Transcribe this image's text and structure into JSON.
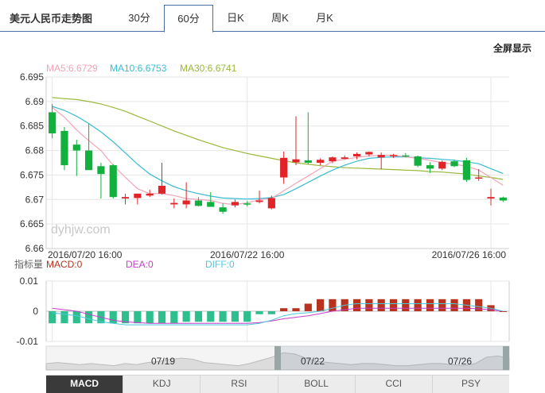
{
  "header": {
    "title": "美元人民币走势图",
    "tabs": [
      {
        "label": "30分",
        "active": false
      },
      {
        "label": "60分",
        "active": true
      },
      {
        "label": "日K",
        "active": false
      },
      {
        "label": "周K",
        "active": false
      },
      {
        "label": "月K",
        "active": false
      }
    ]
  },
  "fullscreen_label": "全屏显示",
  "watermark": "dyhjw.com",
  "colors": {
    "up": "#e2242a",
    "down": "#12b03c",
    "ma5": "#f4a4b6",
    "ma10": "#38bcd4",
    "ma30": "#9ab83c",
    "macd_pos": "#b8321e",
    "macd_neg": "#2fbf8e",
    "dea": "#c83cc8",
    "diff": "#4cc8e0"
  },
  "chart_data": [
    {
      "type": "candlestick",
      "legend": [
        {
          "label": "MA5:6.6729",
          "color": "#f4a4b6"
        },
        {
          "label": "MA10:6.6753",
          "color": "#38bcd4"
        },
        {
          "label": "MA30:6.6741",
          "color": "#9ab83c"
        }
      ],
      "ylim": [
        6.66,
        6.695
      ],
      "yticks": [
        "6.695",
        "6.69",
        "6.685",
        "6.68",
        "6.675",
        "6.67",
        "6.665",
        "6.66"
      ],
      "x_labels": [
        {
          "index": 0,
          "label": "2016/07/20 16:00"
        },
        {
          "index": 16,
          "label": "2016/07/22 16:00"
        },
        {
          "index": 36,
          "label": "2016/07/26 16:00"
        }
      ],
      "candles": [
        {
          "o": 6.6878,
          "h": 6.6895,
          "l": 6.6825,
          "c": 6.6835
        },
        {
          "o": 6.684,
          "h": 6.6848,
          "l": 6.676,
          "c": 6.677
        },
        {
          "o": 6.6812,
          "h": 6.6822,
          "l": 6.6748,
          "c": 6.68
        },
        {
          "o": 6.68,
          "h": 6.6855,
          "l": 6.677,
          "c": 6.676
        },
        {
          "o": 6.6768,
          "h": 6.6775,
          "l": 6.6702,
          "c": 6.6752
        },
        {
          "o": 6.677,
          "h": 6.6772,
          "l": 6.6702,
          "c": 6.6705
        },
        {
          "o": 6.6702,
          "h": 6.6712,
          "l": 6.669,
          "c": 6.6705
        },
        {
          "o": 6.6703,
          "h": 6.6712,
          "l": 6.669,
          "c": 6.6712
        },
        {
          "o": 6.6708,
          "h": 6.672,
          "l": 6.6705,
          "c": 6.6712
        },
        {
          "o": 6.6712,
          "h": 6.6775,
          "l": 6.671,
          "c": 6.6728
        },
        {
          "o": 6.669,
          "h": 6.6702,
          "l": 6.6682,
          "c": 6.6693
        },
        {
          "o": 6.669,
          "h": 6.6735,
          "l": 6.6682,
          "c": 6.6698
        },
        {
          "o": 6.6698,
          "h": 6.6705,
          "l": 6.6686,
          "c": 6.6687
        },
        {
          "o": 6.6695,
          "h": 6.6715,
          "l": 6.6685,
          "c": 6.6685
        },
        {
          "o": 6.6684,
          "h": 6.6692,
          "l": 6.6671,
          "c": 6.6675
        },
        {
          "o": 6.6688,
          "h": 6.67,
          "l": 6.6684,
          "c": 6.6695
        },
        {
          "o": 6.6692,
          "h": 6.6697,
          "l": 6.6686,
          "c": 6.669
        },
        {
          "o": 6.6695,
          "h": 6.6718,
          "l": 6.6692,
          "c": 6.6698
        },
        {
          "o": 6.6682,
          "h": 6.6708,
          "l": 6.668,
          "c": 6.6703
        },
        {
          "o": 6.6745,
          "h": 6.6798,
          "l": 6.6732,
          "c": 6.6785
        },
        {
          "o": 6.6776,
          "h": 6.687,
          "l": 6.677,
          "c": 6.6782
        },
        {
          "o": 6.678,
          "h": 6.6878,
          "l": 6.6772,
          "c": 6.6775
        },
        {
          "o": 6.6775,
          "h": 6.6784,
          "l": 6.677,
          "c": 6.6781
        },
        {
          "o": 6.6778,
          "h": 6.6788,
          "l": 6.6774,
          "c": 6.6786
        },
        {
          "o": 6.6783,
          "h": 6.679,
          "l": 6.6782,
          "c": 6.6786
        },
        {
          "o": 6.6788,
          "h": 6.6796,
          "l": 6.6782,
          "c": 6.6793
        },
        {
          "o": 6.6792,
          "h": 6.6798,
          "l": 6.6788,
          "c": 6.6797
        },
        {
          "o": 6.6786,
          "h": 6.6796,
          "l": 6.6762,
          "c": 6.6791
        },
        {
          "o": 6.6789,
          "h": 6.6793,
          "l": 6.6785,
          "c": 6.6791
        },
        {
          "o": 6.679,
          "h": 6.6795,
          "l": 6.6786,
          "c": 6.6788
        },
        {
          "o": 6.6788,
          "h": 6.679,
          "l": 6.6766,
          "c": 6.6769
        },
        {
          "o": 6.677,
          "h": 6.6776,
          "l": 6.6754,
          "c": 6.6763
        },
        {
          "o": 6.6763,
          "h": 6.678,
          "l": 6.676,
          "c": 6.6777
        },
        {
          "o": 6.6778,
          "h": 6.6781,
          "l": 6.6766,
          "c": 6.6768
        },
        {
          "o": 6.678,
          "h": 6.6785,
          "l": 6.6736,
          "c": 6.674
        },
        {
          "o": 6.6743,
          "h": 6.6762,
          "l": 6.6738,
          "c": 6.6745
        },
        {
          "o": 6.6702,
          "h": 6.6722,
          "l": 6.6688,
          "c": 6.6705
        },
        {
          "o": 6.6704,
          "h": 6.6706,
          "l": 6.6695,
          "c": 6.6698
        }
      ],
      "ma5": [
        6.6888,
        6.6868,
        6.6842,
        6.682,
        6.68,
        6.677,
        6.6745,
        6.6722,
        6.6712,
        6.6712,
        6.6708,
        6.6702,
        6.67,
        6.6698,
        6.6692,
        6.669,
        6.6693,
        6.67,
        6.6702,
        6.6718,
        6.6733,
        6.6748,
        6.6763,
        6.6778,
        6.6782,
        6.6786,
        6.6789,
        6.679,
        6.679,
        6.6787,
        6.6784,
        6.678,
        6.6775,
        6.6772,
        6.6768,
        6.676,
        6.6745,
        6.6729
      ],
      "ma10": [
        6.689,
        6.6882,
        6.687,
        6.6855,
        6.6838,
        6.6818,
        6.6795,
        6.6772,
        6.6752,
        6.6738,
        6.6726,
        6.6718,
        6.6712,
        6.6707,
        6.6703,
        6.6702,
        6.6701,
        6.6702,
        6.6704,
        6.671,
        6.6722,
        6.6735,
        6.6748,
        6.676,
        6.677,
        6.6778,
        6.6784,
        6.6786,
        6.6787,
        6.6787,
        6.6785,
        6.6784,
        6.6782,
        6.678,
        6.6777,
        6.6773,
        6.6763,
        6.6753
      ],
      "ma30": [
        6.6908,
        6.6906,
        6.6904,
        6.69,
        6.6895,
        6.6888,
        6.688,
        6.687,
        6.686,
        6.685,
        6.684,
        6.6831,
        6.6822,
        6.6814,
        6.6806,
        6.68,
        6.6794,
        6.6789,
        6.6784,
        6.6779,
        6.6775,
        6.6772,
        6.6769,
        6.6767,
        6.6765,
        6.6764,
        6.6763,
        6.6762,
        6.6761,
        6.676,
        6.6759,
        6.6757,
        6.6756,
        6.6754,
        6.6752,
        6.6748,
        6.6745,
        6.6741
      ]
    },
    {
      "type": "bar",
      "indicator_label": "指标量",
      "legend": [
        {
          "label": "MACD:0",
          "color": "#b8321e"
        },
        {
          "label": "DEA:0",
          "color": "#c83cc8"
        },
        {
          "label": "DIFF:0",
          "color": "#4cc8e0"
        }
      ],
      "ylim": [
        -0.01,
        0.01
      ],
      "yticks": [
        "0.01",
        "0",
        "-0.01"
      ],
      "macd": [
        -0.004,
        -0.004,
        -0.004,
        -0.004,
        -0.004,
        -0.004,
        -0.004,
        -0.004,
        -0.004,
        -0.004,
        -0.004,
        -0.0035,
        -0.0035,
        -0.0035,
        -0.0035,
        -0.0035,
        -0.0035,
        -0.001,
        -0.001,
        0.001,
        0.001,
        0.0025,
        0.004,
        0.004,
        0.004,
        0.004,
        0.004,
        0.004,
        0.004,
        0.004,
        0.004,
        0.004,
        0.004,
        0.004,
        0.004,
        0.004,
        0.002,
        0.0
      ],
      "dea": [
        0.001,
        0.0005,
        0.0,
        -0.001,
        -0.002,
        -0.003,
        -0.0035,
        -0.0038,
        -0.004,
        -0.004,
        -0.004,
        -0.004,
        -0.004,
        -0.004,
        -0.004,
        -0.004,
        -0.004,
        -0.0038,
        -0.0032,
        -0.0025,
        -0.002,
        -0.0015,
        -0.0008,
        0.0,
        0.0005,
        0.001,
        0.001,
        0.001,
        0.001,
        0.001,
        0.001,
        0.001,
        0.001,
        0.001,
        0.001,
        0.0008,
        0.0005,
        0.0
      ],
      "diff": [
        -0.0005,
        -0.001,
        -0.0015,
        -0.0025,
        -0.0035,
        -0.004,
        -0.0045,
        -0.0045,
        -0.0045,
        -0.0045,
        -0.0045,
        -0.0045,
        -0.0045,
        -0.0045,
        -0.0045,
        -0.0045,
        -0.0045,
        -0.004,
        -0.003,
        -0.0015,
        -0.0008,
        -0.0005,
        0.0,
        0.001,
        0.002,
        0.0025,
        0.0025,
        0.0025,
        0.0025,
        0.0025,
        0.0025,
        0.0025,
        0.0025,
        0.0025,
        0.002,
        0.0015,
        0.001,
        0.0
      ]
    }
  ],
  "navigator": {
    "labels": [
      "07/19",
      "07/22",
      "07/26"
    ],
    "selection": [
      0.5,
      1.0
    ],
    "profile": [
      0.3,
      0.35,
      0.3,
      0.25,
      0.3,
      0.25,
      0.2,
      0.3,
      0.25,
      0.35,
      0.4,
      0.5,
      0.55,
      0.5,
      0.35,
      0.3,
      0.25,
      0.2,
      0.3,
      0.45,
      0.6,
      0.8,
      0.75,
      0.55,
      0.4,
      0.35,
      0.3,
      0.25,
      0.3,
      0.3,
      0.25,
      0.2,
      0.2,
      0.25,
      0.3,
      0.3,
      0.25,
      0.2,
      0.3,
      0.6,
      0.65,
      0.55
    ]
  },
  "bottom_tabs": [
    {
      "label": "MACD",
      "active": true
    },
    {
      "label": "KDJ",
      "active": false
    },
    {
      "label": "RSI",
      "active": false
    },
    {
      "label": "BOLL",
      "active": false
    },
    {
      "label": "CCI",
      "active": false
    },
    {
      "label": "PSY",
      "active": false
    }
  ]
}
